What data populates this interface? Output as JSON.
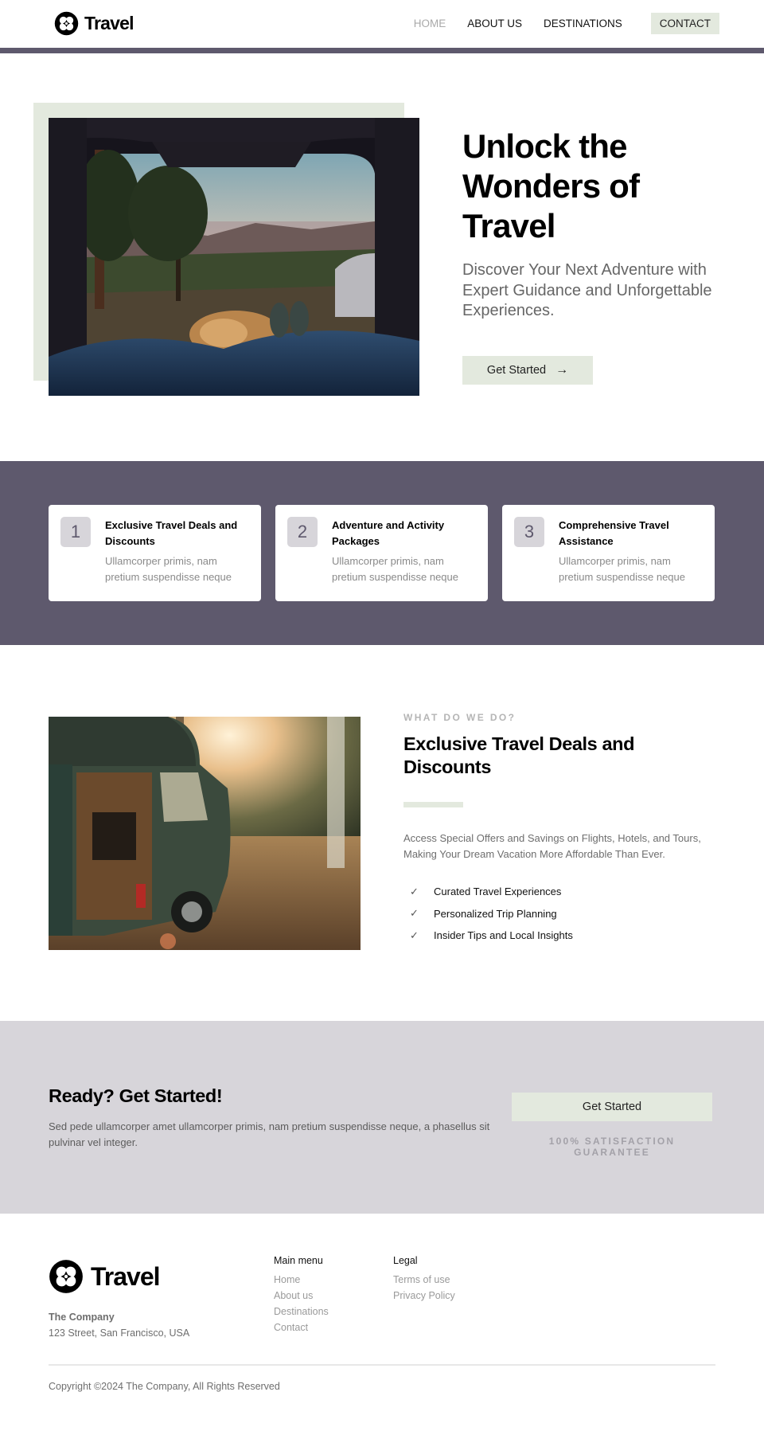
{
  "brand": {
    "name": "Travel",
    "logo_icon": "quatrefoil-circle-logo"
  },
  "colors": {
    "primary": "#5e596d",
    "accent": "#e3e9de",
    "muted": "#d7d5da"
  },
  "nav": {
    "items": [
      {
        "label": "HOME",
        "active": true
      },
      {
        "label": "ABOUT US",
        "active": false
      },
      {
        "label": "DESTINATIONS",
        "active": false
      },
      {
        "label": "CONTACT",
        "active": false
      }
    ]
  },
  "hero": {
    "title": "Unlock the Wonders of Travel",
    "subtitle": "Discover Your Next Adventure with Expert Guidance and Unforgettable Experiences.",
    "button_label": "Get Started",
    "button_icon": "arrow-right-icon",
    "image_alt": "View from the open trunk of a car: people and a dog under blankets overlooking a canyon at sunset"
  },
  "features": [
    {
      "number": "1",
      "title": "Exclusive Travel Deals and Discounts",
      "desc": "Ullamcorper primis, nam pretium suspendisse neque"
    },
    {
      "number": "2",
      "title": "Adventure and Activity Packages",
      "desc": "Ullamcorper primis, nam pretium suspendisse neque"
    },
    {
      "number": "3",
      "title": "Comprehensive Travel Assistance",
      "desc": "Ullamcorper primis, nam pretium suspendisse neque"
    }
  ],
  "what": {
    "eyebrow": "WHAT DO WE DO?",
    "title": "Exclusive Travel Deals and Discounts",
    "desc": "Access Special Offers and Savings on Flights, Hotels, and Tours, Making Your Dream Vacation More Affordable Than Ever.",
    "checklist": [
      "Curated Travel Experiences",
      "Personalized Trip Planning",
      "Insider Tips and Local Insights"
    ],
    "image_alt": "Green camper van parked in a forest clearing at sunset"
  },
  "cta": {
    "title": "Ready? Get Started!",
    "text": "Sed pede ullamcorper amet ullamcorper primis, nam pretium suspendisse neque, a phasellus sit pulvinar vel integer.",
    "button_label": "Get Started",
    "note": "100% SATISFACTION GUARANTEE"
  },
  "footer": {
    "company": "The Company",
    "address": "123 Street, San Francisco, USA",
    "main_menu": {
      "heading": "Main menu",
      "links": [
        "Home",
        "About us",
        "Destinations",
        "Contact"
      ]
    },
    "legal": {
      "heading": "Legal",
      "links": [
        "Terms of use",
        "Privacy Policy"
      ]
    },
    "copyright": "Copyright ©2024 The Company, All Rights Reserved"
  }
}
